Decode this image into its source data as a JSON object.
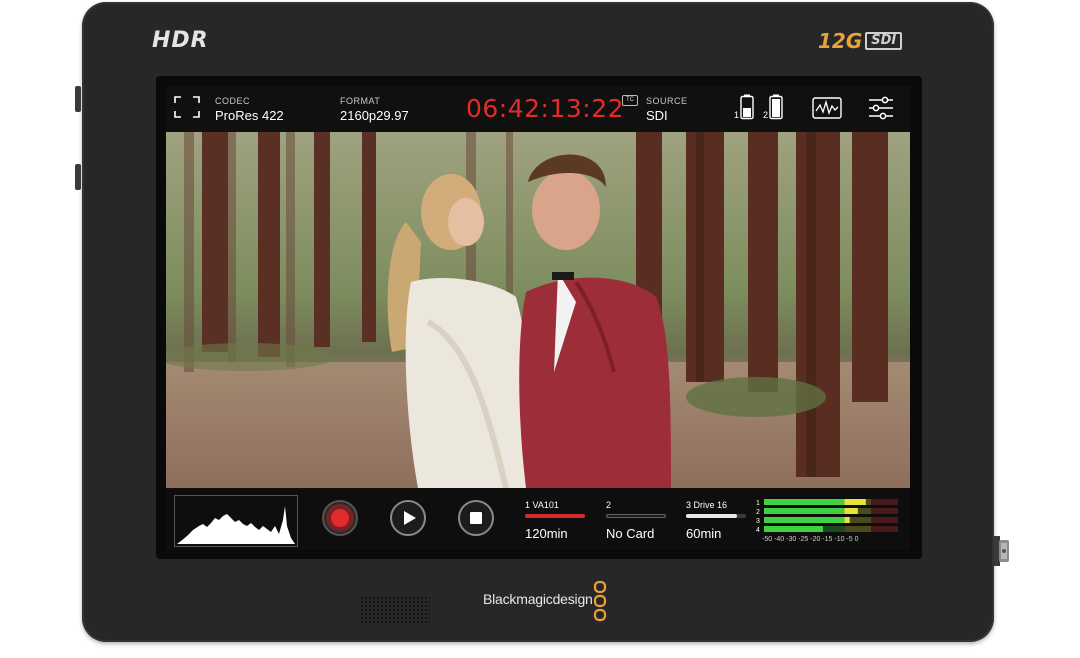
{
  "device": {
    "hdr_logo": "HDR",
    "sdi_badge_prefix": "12G",
    "sdi_badge_suffix": "SDI",
    "brand_name": "Blackmagicdesign",
    "accent_orange": "#e8a235"
  },
  "topbar": {
    "codec_label": "CODEC",
    "codec_value": "ProRes 422",
    "format_label": "FORMAT",
    "format_value": "2160p29.97",
    "timecode": "06:42:13:22",
    "tc_icon": "TC",
    "source_label": "SOURCE",
    "source_value": "SDI",
    "battery_1_label": "1",
    "battery_2_label": "2",
    "icons": [
      "fullscreen-icon",
      "battery-icon",
      "waveform-scope-icon",
      "settings-sliders-icon"
    ],
    "timecode_color": "#e42b2b"
  },
  "transport": {
    "icons": [
      "histogram-icon",
      "record-icon",
      "play-icon",
      "stop-icon"
    ],
    "record_color": "#e42b2b"
  },
  "media_slots": [
    {
      "label": "1  VA101",
      "value": "120min",
      "fill": 1.0,
      "color": "#d62c2c"
    },
    {
      "label": "2",
      "value": "No Card",
      "fill": 0.0,
      "color": "#3a3a3a"
    },
    {
      "label": "3  Drive 16",
      "value": "60min",
      "fill": 0.85,
      "color": "#e8e8e8"
    }
  ],
  "audio_meters": {
    "channel_labels": [
      "1",
      "2",
      "3",
      "4"
    ],
    "scale_text": "-50 -40  -30 -25 -20  -15  -10   -5    0",
    "levels_db": [
      -12,
      -15,
      -18,
      -28
    ]
  }
}
